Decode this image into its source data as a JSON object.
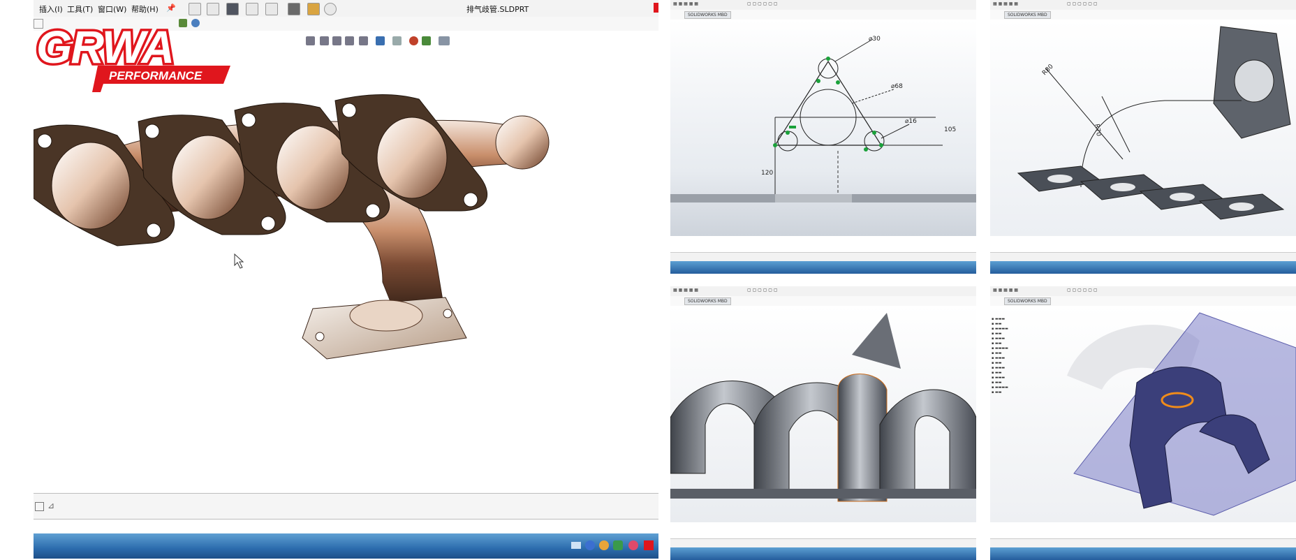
{
  "main_window": {
    "menu": [
      "插入(I)",
      "工具(T)",
      "窗口(W)",
      "帮助(H)"
    ],
    "file_title": "排气歧管.SLDPRT"
  },
  "logo": {
    "brand": "GRWA",
    "tagline": "PERFORMANCE"
  },
  "thumbnails": [
    {
      "tab": "SOLIDWORKS MBD",
      "sketch_dimensions": [
        "⌀30",
        "⌀68",
        "⌀16",
        "105",
        "120"
      ]
    },
    {
      "tab": "SOLIDWORKS MBD",
      "sketch_dimensions": [
        "R80",
        "R70"
      ]
    },
    {
      "tab": "SOLIDWORKS MBD"
    },
    {
      "tab": "SOLIDWORKS MBD"
    }
  ],
  "colors": {
    "brand_red": "#e0161d",
    "taskbar_blue": "#2c6cad",
    "flange_bronze": "#4a3526",
    "pipe_gray": "#7b7f86",
    "plane_blue": "#7d7fc8"
  }
}
